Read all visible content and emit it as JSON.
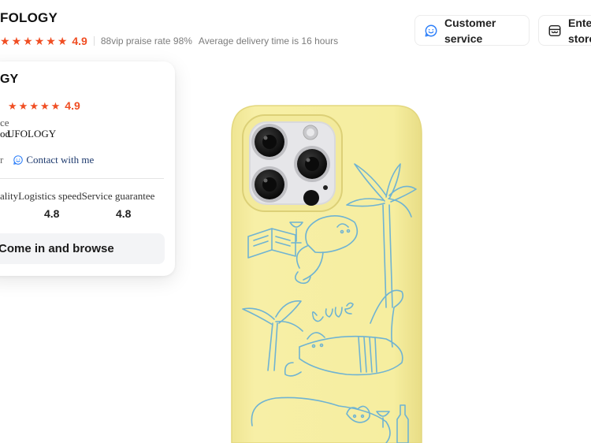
{
  "store": {
    "title": "FOLOGY",
    "rating": "4.9",
    "praise_rate": "88vip praise rate 98%",
    "delivery": "Average delivery time is 16 hours"
  },
  "header_buttons": {
    "customer_service": "Customer service",
    "enter_store": "Enter store"
  },
  "card": {
    "title": "GY",
    "rating": "4.9",
    "line1": "ce",
    "line2_prefix": "od",
    "line2_name": "UFOLOGY",
    "follow": "r",
    "contact": "Contact with me",
    "scores": {
      "quality_label": "ality",
      "logistics_label": "Logistics speed",
      "service_label": "Service guarantee",
      "logistics_value": "4.8",
      "service_value": "4.8"
    },
    "browse_button": "Come in and browse"
  },
  "colors": {
    "accent": "#f04e23",
    "link": "#1e3a6e",
    "case_yellow": "#f6eea0",
    "doodle_blue": "#6fb3d2"
  },
  "icons": {
    "star": "star-icon",
    "customer_service": "smile-chat-icon",
    "store": "store-icon",
    "contact": "smile-chat-icon"
  }
}
